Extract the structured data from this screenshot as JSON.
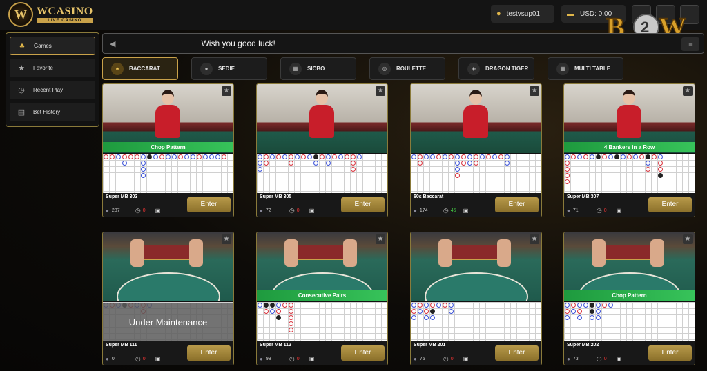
{
  "header": {
    "logo_mark": "W",
    "logo_main": "WCASINO",
    "logo_sub": "LIVE CASINO",
    "username": "testvsup01",
    "balance": "USD: 0.00",
    "brand_badge": "B2W"
  },
  "sidebar": {
    "items": [
      {
        "label": "Games",
        "icon": "club-icon",
        "active": true
      },
      {
        "label": "Favorite",
        "icon": "star-icon",
        "active": false
      },
      {
        "label": "Recent Play",
        "icon": "history-icon",
        "active": false
      },
      {
        "label": "Bet History",
        "icon": "document-icon",
        "active": false
      }
    ]
  },
  "announcement": {
    "message": "Wish you good luck!"
  },
  "tabs": [
    {
      "label": "BACCARAT",
      "active": true
    },
    {
      "label": "SEDIE",
      "active": false
    },
    {
      "label": "SICBO",
      "active": false
    },
    {
      "label": "ROULETTE",
      "active": false
    },
    {
      "label": "DRAGON TIGER",
      "active": false
    },
    {
      "label": "MULTI TABLE",
      "active": false
    }
  ],
  "tables": [
    {
      "name": "Super MB 303",
      "players": "287",
      "countdown": "0",
      "banner": "Chop Pattern",
      "maintenance": "",
      "enter": "Enter"
    },
    {
      "name": "Super MB 305",
      "players": "72",
      "countdown": "0",
      "banner": "",
      "maintenance": "",
      "enter": "Enter"
    },
    {
      "name": "60s Baccarat",
      "players": "174",
      "countdown": "45",
      "banner": "",
      "maintenance": "",
      "enter": "Enter"
    },
    {
      "name": "Super MB 307",
      "players": "71",
      "countdown": "0",
      "banner": "4 Bankers in a Row",
      "maintenance": "",
      "enter": "Enter"
    },
    {
      "name": "Super MB 111",
      "players": "0",
      "countdown": "0",
      "banner": "",
      "maintenance": "Under Maintenance",
      "enter": "Enter"
    },
    {
      "name": "Super MB 112",
      "players": "98",
      "countdown": "0",
      "banner": "Consecutive Pairs",
      "maintenance": "",
      "enter": "Enter"
    },
    {
      "name": "Super MB 201",
      "players": "75",
      "countdown": "0",
      "banner": "",
      "maintenance": "",
      "enter": "Enter"
    },
    {
      "name": "Super MB 202",
      "players": "73",
      "countdown": "0",
      "banner": "Chop Pattern",
      "maintenance": "",
      "enter": "Enter"
    }
  ],
  "colors": {
    "gold": "#c9a24a",
    "banker": "#3a50d8",
    "player": "#d8303a",
    "banner_green": "#2bb04c"
  }
}
